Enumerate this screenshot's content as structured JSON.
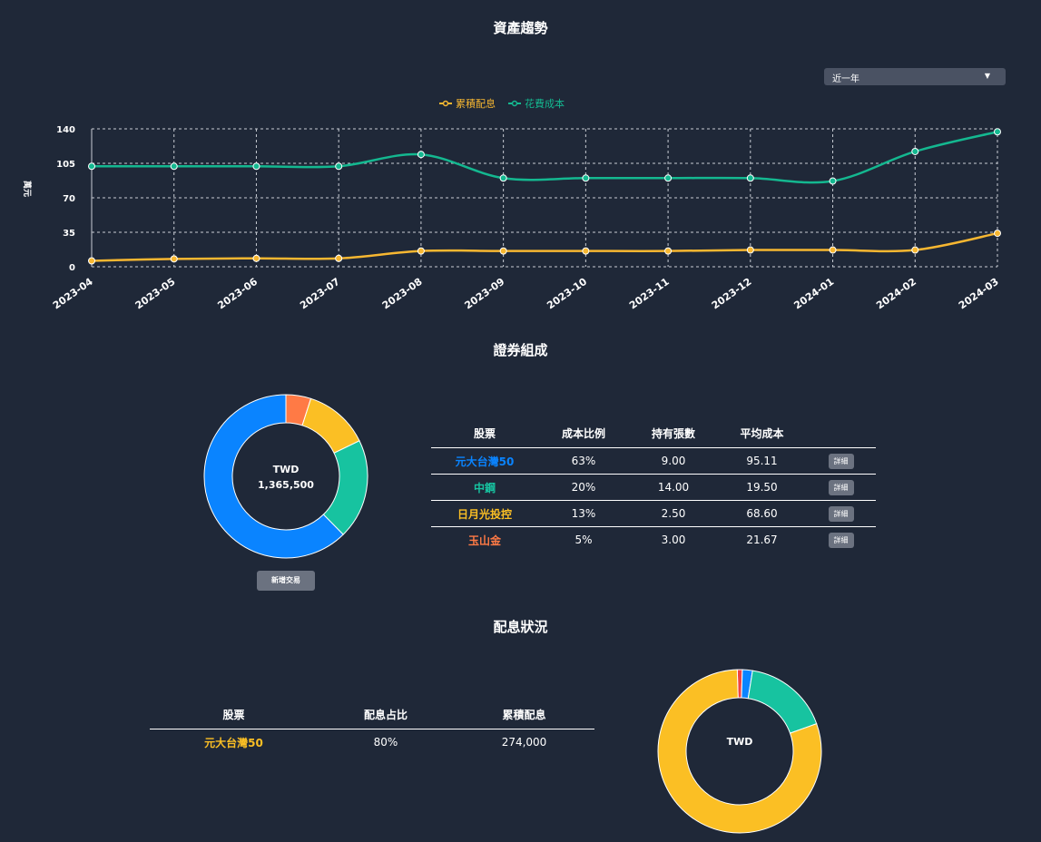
{
  "trend": {
    "title": "資產趨勢",
    "range_select": {
      "value": "近一年"
    },
    "chart_data": {
      "type": "line",
      "x": [
        "2023-04",
        "2023-05",
        "2023-06",
        "2023-07",
        "2023-08",
        "2023-09",
        "2023-10",
        "2023-11",
        "2023-12",
        "2024-01",
        "2024-02",
        "2024-03"
      ],
      "series": [
        {
          "name": "累積配息",
          "color": "#f7b731",
          "values": [
            6,
            8,
            8.5,
            8.5,
            16,
            16,
            16,
            16,
            17,
            17,
            17,
            34
          ]
        },
        {
          "name": "花費成本",
          "color": "#14b890",
          "values": [
            102,
            102,
            102,
            102,
            114,
            90,
            90,
            90,
            90,
            87,
            117,
            137
          ]
        }
      ],
      "ylabel": "萬元",
      "yticks": [
        0,
        35,
        70,
        105,
        140
      ],
      "ylim": [
        0,
        140
      ],
      "grid": true,
      "legend": "top"
    }
  },
  "composition": {
    "title": "證券組成",
    "donut": {
      "currency": "TWD",
      "total": "1,365,500"
    },
    "chart_data": {
      "type": "pie",
      "labels": [
        "元大台灣50",
        "中鋼",
        "日月光投控",
        "玉山金"
      ],
      "values": [
        63,
        20,
        13,
        5
      ],
      "colors": [
        "#0a84ff",
        "#17c3a0",
        "#fbbf24",
        "#ff7a45"
      ]
    },
    "table": {
      "headers": [
        "股票",
        "成本比例",
        "持有張數",
        "平均成本"
      ],
      "rows": [
        {
          "name": "元大台灣50",
          "ratio": "63%",
          "shares": "9.00",
          "avg": "95.11",
          "color": "#0a84ff",
          "detail": "詳細"
        },
        {
          "name": "中鋼",
          "ratio": "20%",
          "shares": "14.00",
          "avg": "19.50",
          "color": "#17c3a0",
          "detail": "詳細"
        },
        {
          "name": "日月光投控",
          "ratio": "13%",
          "shares": "2.50",
          "avg": "68.60",
          "color": "#fbbf24",
          "detail": "詳細"
        },
        {
          "name": "玉山金",
          "ratio": "5%",
          "shares": "3.00",
          "avg": "21.67",
          "color": "#ff7a45",
          "detail": "詳細"
        }
      ]
    },
    "add_button": "新增交易"
  },
  "dividend": {
    "title": "配息狀況",
    "table": {
      "headers": [
        "股票",
        "配息占比",
        "累積配息"
      ],
      "rows": [
        {
          "name": "元大台灣50",
          "ratio": "80%",
          "amount": "274,000",
          "color": "#fbbf24"
        }
      ]
    },
    "donut": {
      "currency": "TWD"
    },
    "chart_data": {
      "type": "pie",
      "values": [
        80,
        17,
        2,
        1
      ],
      "colors": [
        "#fbbf24",
        "#17c3a0",
        "#0a84ff",
        "#ef4444"
      ]
    }
  }
}
